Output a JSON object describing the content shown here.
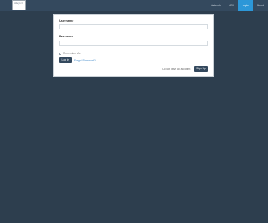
{
  "header": {
    "logo_text": "Alteryx Cl",
    "nav": [
      {
        "label": "Network",
        "active": false
      },
      {
        "label": "API",
        "active": false
      },
      {
        "label": "Login",
        "active": true
      },
      {
        "label": "About",
        "active": false
      }
    ]
  },
  "login_form": {
    "username_label": "Username",
    "username_value": "",
    "password_label": "Password",
    "password_value": "",
    "remember_label": "Remember Me",
    "login_label": "Log in",
    "forgot_label": "Forgot Password?",
    "no_account_text": "Do not have an account?",
    "signup_label": "Sign Up"
  },
  "colors": {
    "background": "#2d3e4e",
    "navbar": "#34495e",
    "active_tab": "#2c97d8",
    "button": "#34495e",
    "link": "#3b86c8"
  }
}
